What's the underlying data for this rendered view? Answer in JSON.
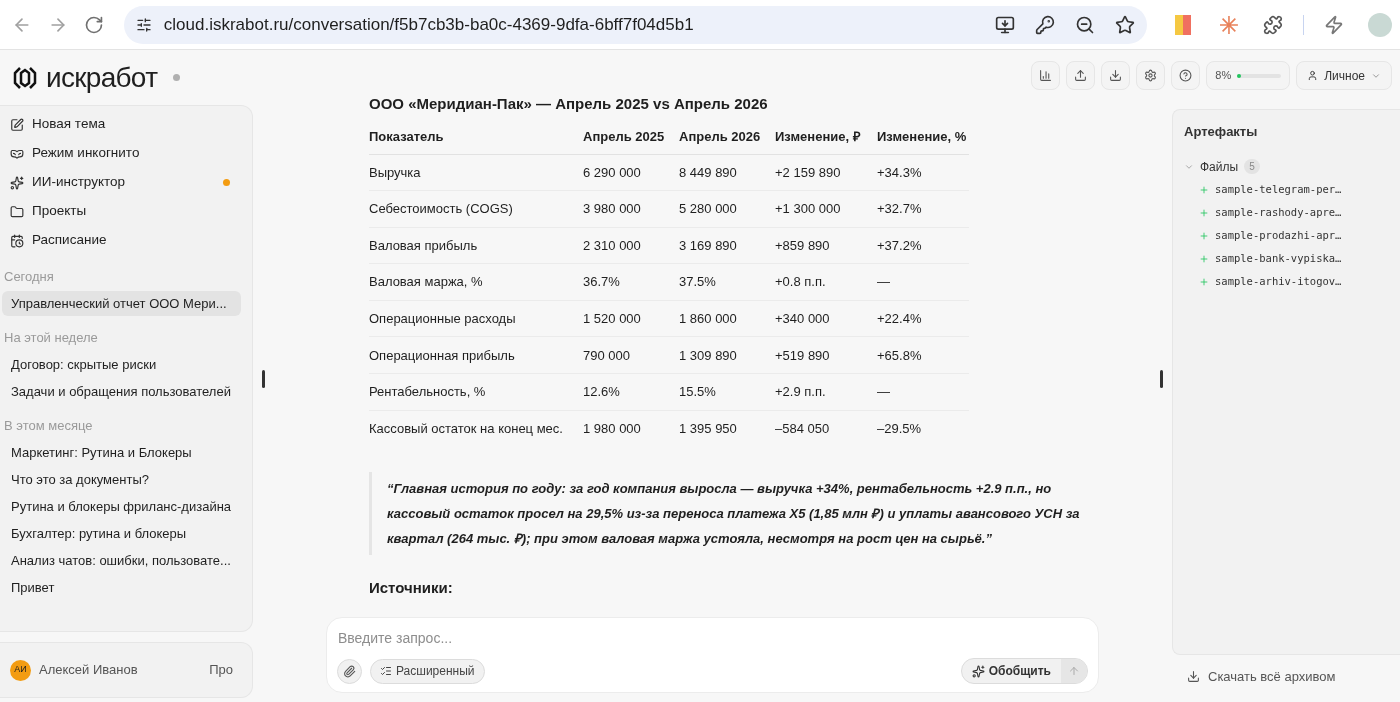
{
  "browser": {
    "url": "cloud.iskrabot.ru/conversation/f5b7cb3b-ba0c-4369-9dfa-6bff7f04d5b1"
  },
  "sidebar": {
    "logo": "искработ",
    "nav": [
      {
        "label": "Новая тема",
        "kind": "new",
        "dot": false
      },
      {
        "label": "Режим инкогнито",
        "kind": "incognito",
        "dot": false
      },
      {
        "label": "ИИ-инструктор",
        "kind": "sparkle",
        "dot": true
      },
      {
        "label": "Проекты",
        "kind": "folder",
        "dot": false
      },
      {
        "label": "Расписание",
        "kind": "calendar",
        "dot": false
      }
    ],
    "groups": [
      {
        "title": "Сегодня",
        "items": [
          {
            "label": "Управленческий отчет ООО Мери...",
            "selected": true
          }
        ]
      },
      {
        "title": "На этой неделе",
        "items": [
          {
            "label": "Договор: скрытые риски",
            "selected": false
          },
          {
            "label": "Задачи и обращения пользователей",
            "selected": false
          }
        ]
      },
      {
        "title": "В этом месяце",
        "items": [
          {
            "label": "Маркетинг: Рутина и Блокеры",
            "selected": false
          },
          {
            "label": "Что это за документы?",
            "selected": false
          },
          {
            "label": "Рутина и блокеры фриланс-дизайна",
            "selected": false
          },
          {
            "label": "Бухгалтер: рутина и блокеры",
            "selected": false
          },
          {
            "label": "Анализ чатов: ошибки, пользовате...",
            "selected": false
          },
          {
            "label": "Привет",
            "selected": false
          }
        ]
      }
    ],
    "user": {
      "initials": "АИ",
      "name": "Алексей Иванов",
      "plan": "Про"
    }
  },
  "toolbar": {
    "usage": "8%",
    "level": 0.08,
    "profile": "Личное"
  },
  "message": {
    "title": "ООО «Меридиан-Пак» — Апрель 2025 vs Апрель 2026",
    "table": {
      "columns": [
        "Показатель",
        "Апрель 2025",
        "Апрель 2026",
        "Изменение, ₽",
        "Изменение, %"
      ],
      "rows": [
        [
          "Выручка",
          "6 290 000",
          "8 449 890",
          "+2 159 890",
          "+34.3%"
        ],
        [
          "Себестоимость (COGS)",
          "3 980 000",
          "5 280 000",
          "+1 300 000",
          "+32.7%"
        ],
        [
          "Валовая прибыль",
          "2 310 000",
          "3 169 890",
          "+859 890",
          "+37.2%"
        ],
        [
          "Валовая маржа, %",
          "36.7%",
          "37.5%",
          "+0.8 п.п.",
          "—"
        ],
        [
          "Операционные расходы",
          "1 520 000",
          "1 860 000",
          "+340 000",
          "+22.4%"
        ],
        [
          "Операционная прибыль",
          "790 000",
          "1 309 890",
          "+519 890",
          "+65.8%"
        ],
        [
          "Рентабельность, %",
          "12.6%",
          "15.5%",
          "+2.9 п.п.",
          "—"
        ],
        [
          "Кассовый остаток на конец мес.",
          "1 980 000",
          "1 395 950",
          "–584 050",
          "–29.5%"
        ]
      ]
    },
    "quote": "“Главная история по году: за год компания выросла — выручка +34%, рентабельность +2.9 п.п., но кассовый остаток просел на 29,5% из-за переноса платежа X5 (1,85 млн ₽) и уплаты авансового УСН за квартал (264 тыс. ₽); при этом валовая маржа устояла, несмотря на рост цен на сырьё.”",
    "sources_heading": "Источники:"
  },
  "composer": {
    "placeholder": "Введите запрос...",
    "mode": "Расширенный",
    "summarize": "Обобщить"
  },
  "artifacts": {
    "title": "Артефакты",
    "folder": "Файлы",
    "count": "5",
    "expanded": true,
    "files": [
      "sample-telegram-per…",
      "sample-rashody-apre…",
      "sample-prodazhi-apr…",
      "sample-bank-vypiska…",
      "sample-arhiv-itogov…"
    ],
    "download": "Скачать всё архивом"
  }
}
